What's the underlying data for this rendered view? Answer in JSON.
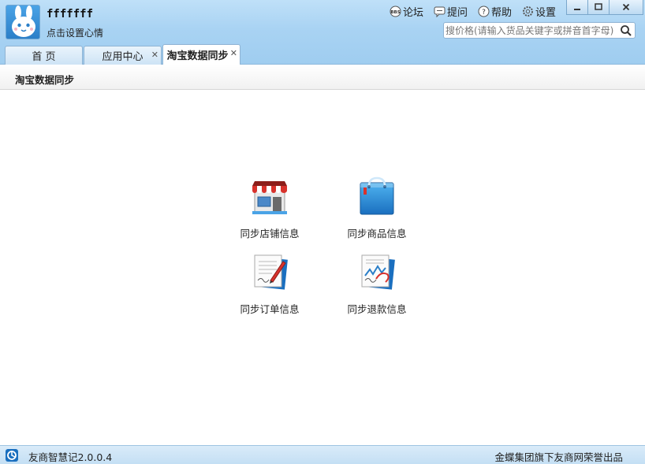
{
  "user": {
    "name": "fffffff",
    "mood_prompt": "点击设置心情",
    "avatar_icon": "bunny-avatar-icon"
  },
  "toplinks": [
    {
      "label": "论坛",
      "icon": "bbs-icon"
    },
    {
      "label": "提问",
      "icon": "chat-bubble-icon"
    },
    {
      "label": "帮助",
      "icon": "question-circle-icon"
    },
    {
      "label": "设置",
      "icon": "gear-icon"
    }
  ],
  "search": {
    "placeholder": "搜价格(请输入货品关键字或拼音首字母)",
    "icon": "search-icon"
  },
  "tabs": [
    {
      "label": "首 页",
      "closable": false,
      "active": false
    },
    {
      "label": "应用中心",
      "closable": true,
      "active": false
    },
    {
      "label": "淘宝数据同步",
      "closable": true,
      "active": true
    }
  ],
  "page": {
    "title": "淘宝数据同步"
  },
  "actions": [
    {
      "label": "同步店铺信息",
      "icon": "storefront-icon"
    },
    {
      "label": "同步商品信息",
      "icon": "shopping-bag-icon"
    },
    {
      "label": "同步订单信息",
      "icon": "order-document-icon"
    },
    {
      "label": "同步退款信息",
      "icon": "refund-document-icon"
    }
  ],
  "status": {
    "version": "友商智慧记2.0.0.4",
    "credit": "金蝶集团旗下友商网荣誉出品"
  },
  "colors": {
    "header_top": "#bfe0f8",
    "header_bottom": "#9fcdf0",
    "accent_blue": "#2b7fc8",
    "awning_red": "#d8322c"
  }
}
